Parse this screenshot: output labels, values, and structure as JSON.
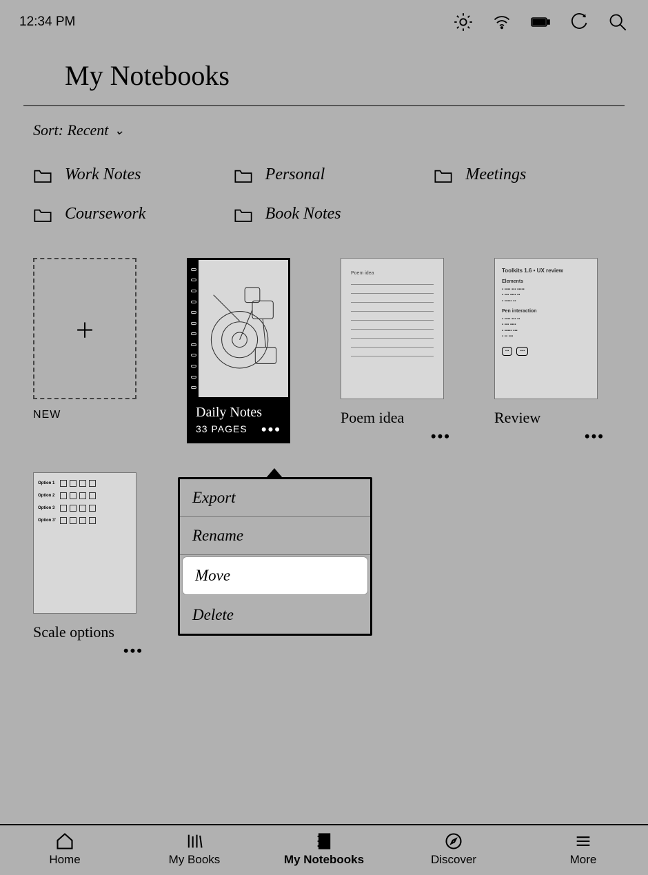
{
  "status": {
    "time": "12:34 PM"
  },
  "page_title": "My Notebooks",
  "sort": {
    "label": "Sort: Recent"
  },
  "folders": [
    {
      "label": "Work Notes"
    },
    {
      "label": "Personal"
    },
    {
      "label": "Meetings"
    },
    {
      "label": "Coursework"
    },
    {
      "label": "Book Notes"
    }
  ],
  "new_label": "NEW",
  "selected_notebook": {
    "title": "Daily Notes",
    "pages_label": "33 PAGES"
  },
  "notebooks_row1": [
    {
      "title": "Poem idea",
      "thumb_title": "Poem idea"
    },
    {
      "title": "Review",
      "thumb_heading": "Toolkits 1.6 • UX review",
      "thumb_sub1": "Elements",
      "thumb_sub2": "Pen interaction"
    }
  ],
  "notebooks_row2": [
    {
      "title": "Scale options"
    }
  ],
  "context_menu": {
    "items": [
      "Export",
      "Rename",
      "Move",
      "Delete"
    ],
    "highlighted_index": 2
  },
  "nav": {
    "items": [
      {
        "label": "Home"
      },
      {
        "label": "My Books"
      },
      {
        "label": "My Notebooks"
      },
      {
        "label": "Discover"
      },
      {
        "label": "More"
      }
    ],
    "active_index": 2
  }
}
